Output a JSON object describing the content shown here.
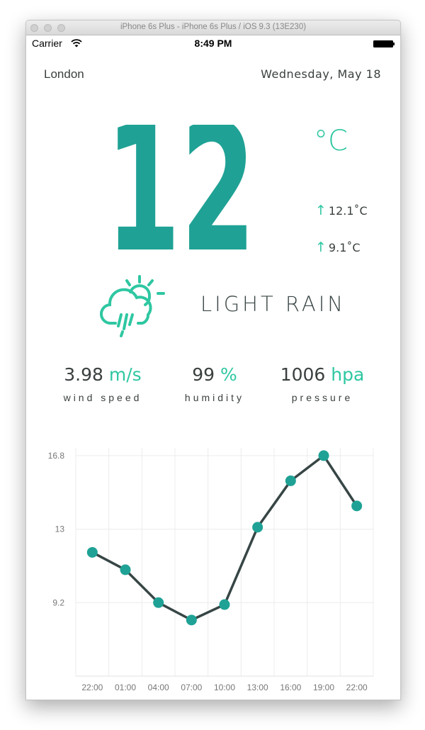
{
  "window": {
    "title": "iPhone 6s Plus - iPhone 6s Plus / iOS 9.3 (13E230)"
  },
  "status_bar": {
    "carrier": "Carrier",
    "time": "8:49 PM"
  },
  "header": {
    "city": "London",
    "date": "Wednesday, May 18"
  },
  "current": {
    "temperature": "12",
    "unit": "°C",
    "high": "12.1˚C",
    "low": "9.1˚C",
    "arrow": "↑",
    "condition": "LIGHT RAIN",
    "condition_icon": "rain-cloud-sun-icon"
  },
  "stats": [
    {
      "value": "3.98",
      "unit": "m/s",
      "label": "wind speed"
    },
    {
      "value": "99",
      "unit": "%",
      "label": "humidity"
    },
    {
      "value": "1006",
      "unit": "hpa",
      "label": "pressure"
    }
  ],
  "colors": {
    "accent": "#2ec7a1",
    "big_temp": "#1fa295",
    "text": "#3a3f3f",
    "line": "#374545",
    "dot": "#1fa295"
  },
  "chart_data": {
    "type": "line",
    "categories": [
      "22:00",
      "01:00",
      "04:00",
      "07:00",
      "10:00",
      "13:00",
      "16:00",
      "19:00",
      "22:00"
    ],
    "values": [
      11.8,
      10.9,
      9.2,
      8.3,
      9.1,
      13.1,
      15.5,
      16.8,
      14.2
    ],
    "y_ticks": [
      "16.8",
      "13",
      "9.2"
    ],
    "y_tick_values": [
      16.8,
      13,
      9.2
    ],
    "ylim": [
      5.4,
      17.2
    ],
    "grid": true
  }
}
